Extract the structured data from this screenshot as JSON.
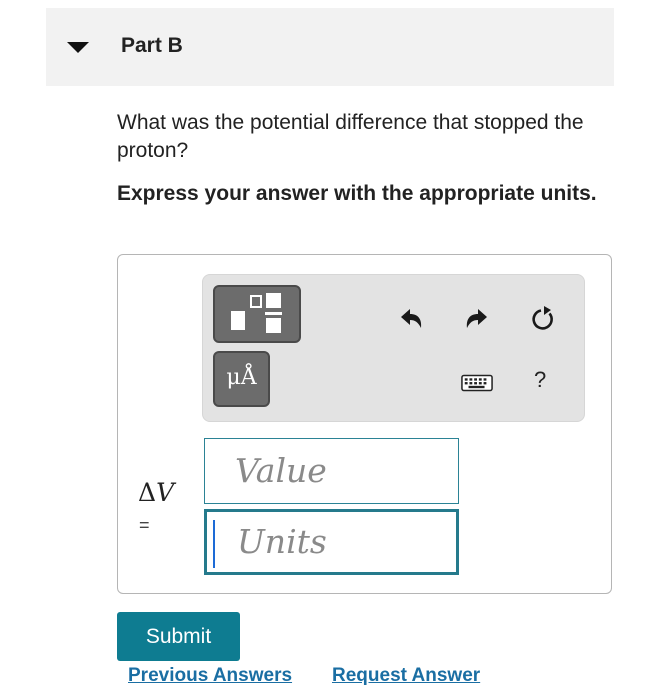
{
  "part": {
    "title": "Part B",
    "expanded_icon": "caret-down-icon"
  },
  "question": {
    "text": "What was the potential difference that stopped the proton?",
    "instruction": "Express your answer with the appropriate units."
  },
  "toolbar": {
    "templates_icon": "fraction-template-icon",
    "units_label": "μÅ",
    "undo_icon": "undo-icon",
    "redo_icon": "redo-icon",
    "reset_icon": "reset-icon",
    "keyboard_icon": "keyboard-icon",
    "help_label": "?"
  },
  "answer": {
    "variable": "ΔV",
    "variable_symbol": "Δ",
    "variable_letter": "V",
    "equals": "=",
    "value_placeholder": "Value",
    "units_placeholder": "Units"
  },
  "actions": {
    "submit_label": "Submit",
    "previous_answers_label": "Previous Answers",
    "request_answer_label": "Request Answer"
  },
  "colors": {
    "accent": "#0e7c91",
    "link": "#1a6ea3",
    "header_bg": "#f2f2f2",
    "toolbar_bg": "#e3e3e3",
    "tool_button": "#6c6c6c"
  }
}
